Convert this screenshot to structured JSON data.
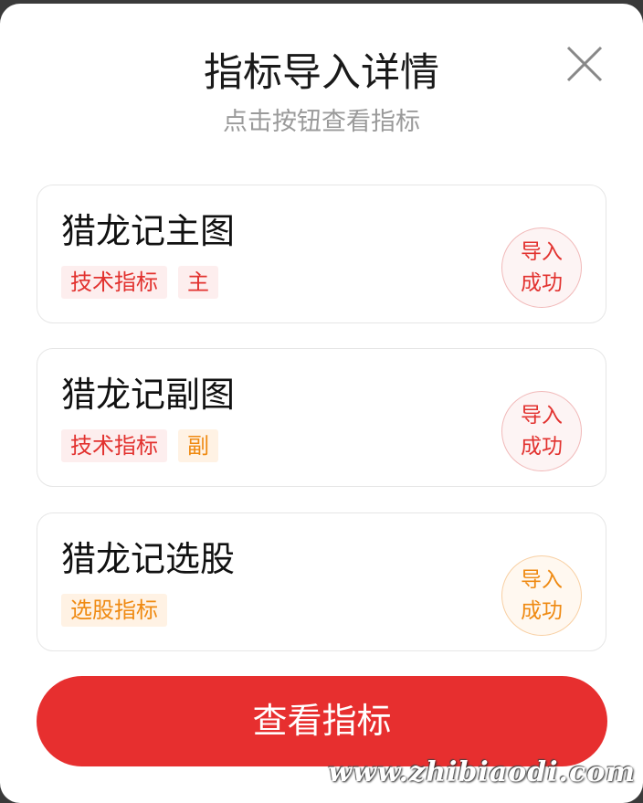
{
  "dialog": {
    "title": "指标导入详情",
    "subtitle": "点击按钮查看指标",
    "close_icon": "close-icon"
  },
  "items": [
    {
      "name": "猎龙记主图",
      "tags": [
        {
          "label": "技术指标",
          "color": "#e2322f"
        },
        {
          "label": "主",
          "color": "#e2322f"
        }
      ],
      "status_line1": "导入",
      "status_line2": "成功",
      "status_color": "#e2322f"
    },
    {
      "name": "猎龙记副图",
      "tags": [
        {
          "label": "技术指标",
          "color": "#e2322f"
        },
        {
          "label": "副",
          "color": "#ef8a12"
        }
      ],
      "status_line1": "导入",
      "status_line2": "成功",
      "status_color": "#e2322f"
    },
    {
      "name": "猎龙记选股",
      "tags": [
        {
          "label": "选股指标",
          "color": "#ef8a12"
        }
      ],
      "status_line1": "导入",
      "status_line2": "成功",
      "status_color": "#ef8a12"
    }
  ],
  "button": {
    "label": "查看指标",
    "color": "#e72f2f"
  },
  "watermark": "www.zhibiaodi.com"
}
